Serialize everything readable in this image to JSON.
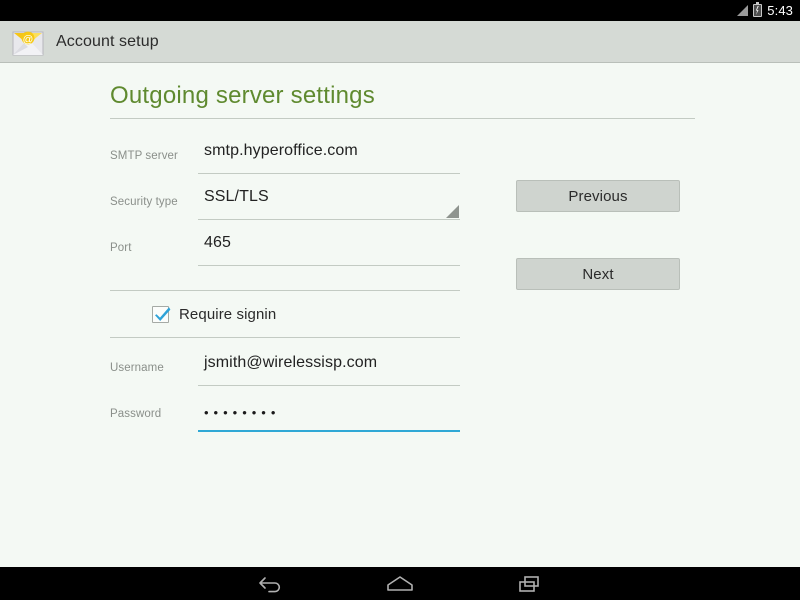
{
  "status_bar": {
    "time": "5:43",
    "icons": [
      "signal-icon",
      "battery-charging-icon"
    ]
  },
  "action_bar": {
    "app_icon": "email-at-envelope-icon",
    "title": "Account setup"
  },
  "page": {
    "heading": "Outgoing server settings",
    "heading_color": "#5f8a2f",
    "accent_focus_color": "#2fa8d5"
  },
  "form": {
    "fields": [
      {
        "label": "SMTP server",
        "value": "smtp.hyperoffice.com",
        "type": "text",
        "focused": false
      },
      {
        "label": "Security type",
        "value": "SSL/TLS",
        "type": "select",
        "focused": false
      },
      {
        "label": "Port",
        "value": "465",
        "type": "text",
        "focused": false
      },
      {
        "label": "Username",
        "value": "jsmith@wirelessisp.com",
        "type": "text",
        "focused": false
      },
      {
        "label": "Password",
        "value": "••••••••",
        "type": "password",
        "focused": true
      }
    ],
    "checkbox": {
      "label": "Require signin",
      "checked": true,
      "check_color": "#2fa3d8"
    }
  },
  "buttons": {
    "previous": "Previous",
    "next": "Next"
  },
  "nav_bar": {
    "back": "back-icon",
    "home": "home-icon",
    "recents": "recents-icon"
  }
}
